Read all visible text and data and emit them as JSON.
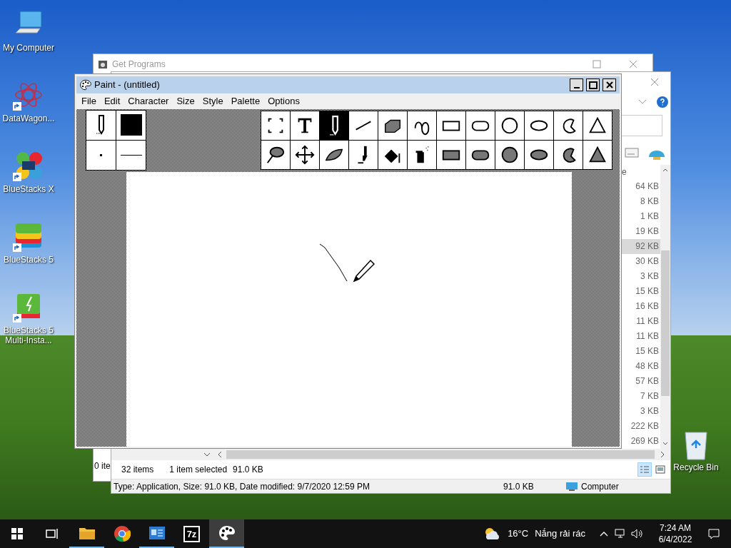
{
  "desktop_icons": [
    {
      "label": "My Computer",
      "kind": "computer",
      "shortcut": false
    },
    {
      "label": "DataWagon...",
      "kind": "atom",
      "shortcut": true
    },
    {
      "label": "BlueStacks X",
      "kind": "bluestacks-x",
      "shortcut": true
    },
    {
      "label": "BlueStacks 5",
      "kind": "bluestacks",
      "shortcut": true
    },
    {
      "label": "BlueStacks 5 Multi-Insta...",
      "kind": "multi-instance",
      "shortcut": true
    }
  ],
  "recycle_bin": {
    "label": "Recycle Bin"
  },
  "get_programs_window": {
    "title": "Get Programs",
    "status": "0 ite"
  },
  "explorer_window": {
    "column_header": "e",
    "file_sizes": [
      {
        "size": "64 KB",
        "selected": false
      },
      {
        "size": "8 KB",
        "selected": false
      },
      {
        "size": "1 KB",
        "selected": false
      },
      {
        "size": "19 KB",
        "selected": false
      },
      {
        "size": "92 KB",
        "selected": true
      },
      {
        "size": "30 KB",
        "selected": false
      },
      {
        "size": "3 KB",
        "selected": false
      },
      {
        "size": "15 KB",
        "selected": false
      },
      {
        "size": "16 KB",
        "selected": false
      },
      {
        "size": "11 KB",
        "selected": false
      },
      {
        "size": "11 KB",
        "selected": false
      },
      {
        "size": "15 KB",
        "selected": false
      },
      {
        "size": "48 KB",
        "selected": false
      },
      {
        "size": "57 KB",
        "selected": false
      },
      {
        "size": "7 KB",
        "selected": false
      },
      {
        "size": "3 KB",
        "selected": false
      },
      {
        "size": "222 KB",
        "selected": false
      },
      {
        "size": "269 KB",
        "selected": false
      }
    ],
    "item_count": "32 items",
    "selection": "1 item selected",
    "selection_size": "91.0 KB",
    "view_modes": [
      {
        "kind": "details",
        "selected": true
      },
      {
        "kind": "large-icons",
        "selected": false
      }
    ],
    "details": "Type: Application, Size: 91.0 KB, Date modified: 9/7/2020 12:59 PM",
    "details_size": "91.0 KB",
    "location": "Computer"
  },
  "paint_window": {
    "title": "Paint - (untitled)",
    "menu": [
      "File",
      "Edit",
      "Character",
      "Size",
      "Style",
      "Palette",
      "Options"
    ],
    "tools": [
      {
        "kind": "select",
        "selected": false
      },
      {
        "kind": "text",
        "selected": false
      },
      {
        "kind": "pencil",
        "selected": true
      },
      {
        "kind": "line",
        "selected": false
      },
      {
        "kind": "eraser",
        "selected": false
      },
      {
        "kind": "curve",
        "selected": false
      },
      {
        "kind": "rectangle",
        "selected": false
      },
      {
        "kind": "rounded-rectangle",
        "selected": false
      },
      {
        "kind": "circle",
        "selected": false
      },
      {
        "kind": "ellipse",
        "selected": false
      },
      {
        "kind": "polygon",
        "selected": false
      },
      {
        "kind": "triangle",
        "selected": false
      },
      {
        "kind": "lasso",
        "selected": false
      },
      {
        "kind": "move",
        "selected": false
      },
      {
        "kind": "brush",
        "selected": false
      },
      {
        "kind": "paintbrush",
        "selected": false
      },
      {
        "kind": "fill",
        "selected": false
      },
      {
        "kind": "spray",
        "selected": false
      },
      {
        "kind": "filled-rectangle",
        "selected": false
      },
      {
        "kind": "filled-rounded-rectangle",
        "selected": false
      },
      {
        "kind": "filled-circle",
        "selected": false
      },
      {
        "kind": "filled-ellipse",
        "selected": false
      },
      {
        "kind": "filled-polygon",
        "selected": false
      },
      {
        "kind": "filled-triangle",
        "selected": false
      }
    ]
  },
  "taskbar": {
    "apps": [
      {
        "kind": "task-view",
        "selected": false,
        "running": false
      },
      {
        "kind": "folder",
        "selected": false,
        "running": true
      },
      {
        "kind": "browser",
        "selected": false,
        "running": false
      },
      {
        "kind": "control-panel",
        "selected": false,
        "running": true
      },
      {
        "kind": "archiver",
        "label": "7z",
        "selected": false,
        "running": false
      },
      {
        "kind": "palette",
        "selected": true,
        "running": true
      }
    ],
    "temperature": "16°C",
    "weather": "Nắng rải rác",
    "time": "7:24 AM",
    "date": "6/4/2022"
  }
}
